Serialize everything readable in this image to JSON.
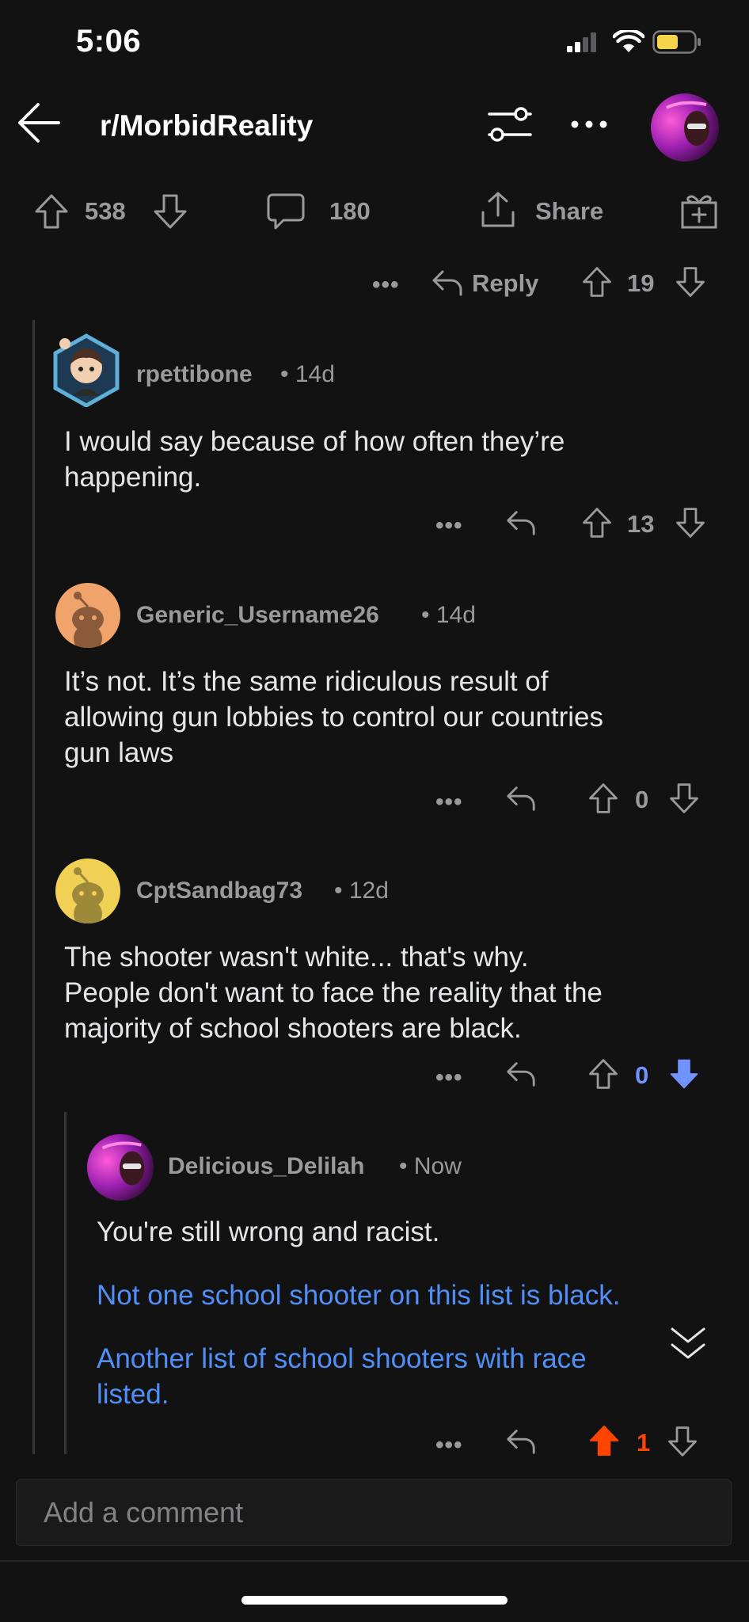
{
  "status_bar": {
    "time": "5:06"
  },
  "header": {
    "subreddit": "r/MorbidReality"
  },
  "post_actions": {
    "upvotes": "538",
    "comments": "180",
    "share_label": "Share"
  },
  "parent_actions": {
    "reply_label": "Reply",
    "votes": "19"
  },
  "comments": [
    {
      "username": "rpettibone",
      "age": "• 14d",
      "lines": [
        "I would say because of how often they’re",
        "happening."
      ],
      "votes": "13"
    },
    {
      "username": "Generic_Username26",
      "age": "• 14d",
      "lines": [
        "It’s not. It’s the same ridiculous result of",
        "allowing gun lobbies to control our countries",
        "gun laws"
      ],
      "votes": "0"
    },
    {
      "username": "CptSandbag73",
      "age": "• 12d",
      "lines": [
        "The shooter wasn't white... that's why.",
        "People don't want to face the reality that the",
        "majority of school shooters are black."
      ],
      "votes": "0"
    },
    {
      "username": "Delicious_Delilah",
      "age": "• Now",
      "lines": [
        "You're still wrong and racist."
      ],
      "links": [
        "Not one school shooter on this list is black.",
        "Another list of school shooters with race",
        "listed."
      ],
      "votes": "1"
    }
  ],
  "dots_label": "•••",
  "comment_bar": {
    "placeholder": "Add a comment"
  },
  "colors": {
    "background": "#121213",
    "link": "#4f8ff7",
    "upvote_active": "#ff4500",
    "downvote_active": "#7193ff",
    "meta": "#9a9a9c"
  }
}
